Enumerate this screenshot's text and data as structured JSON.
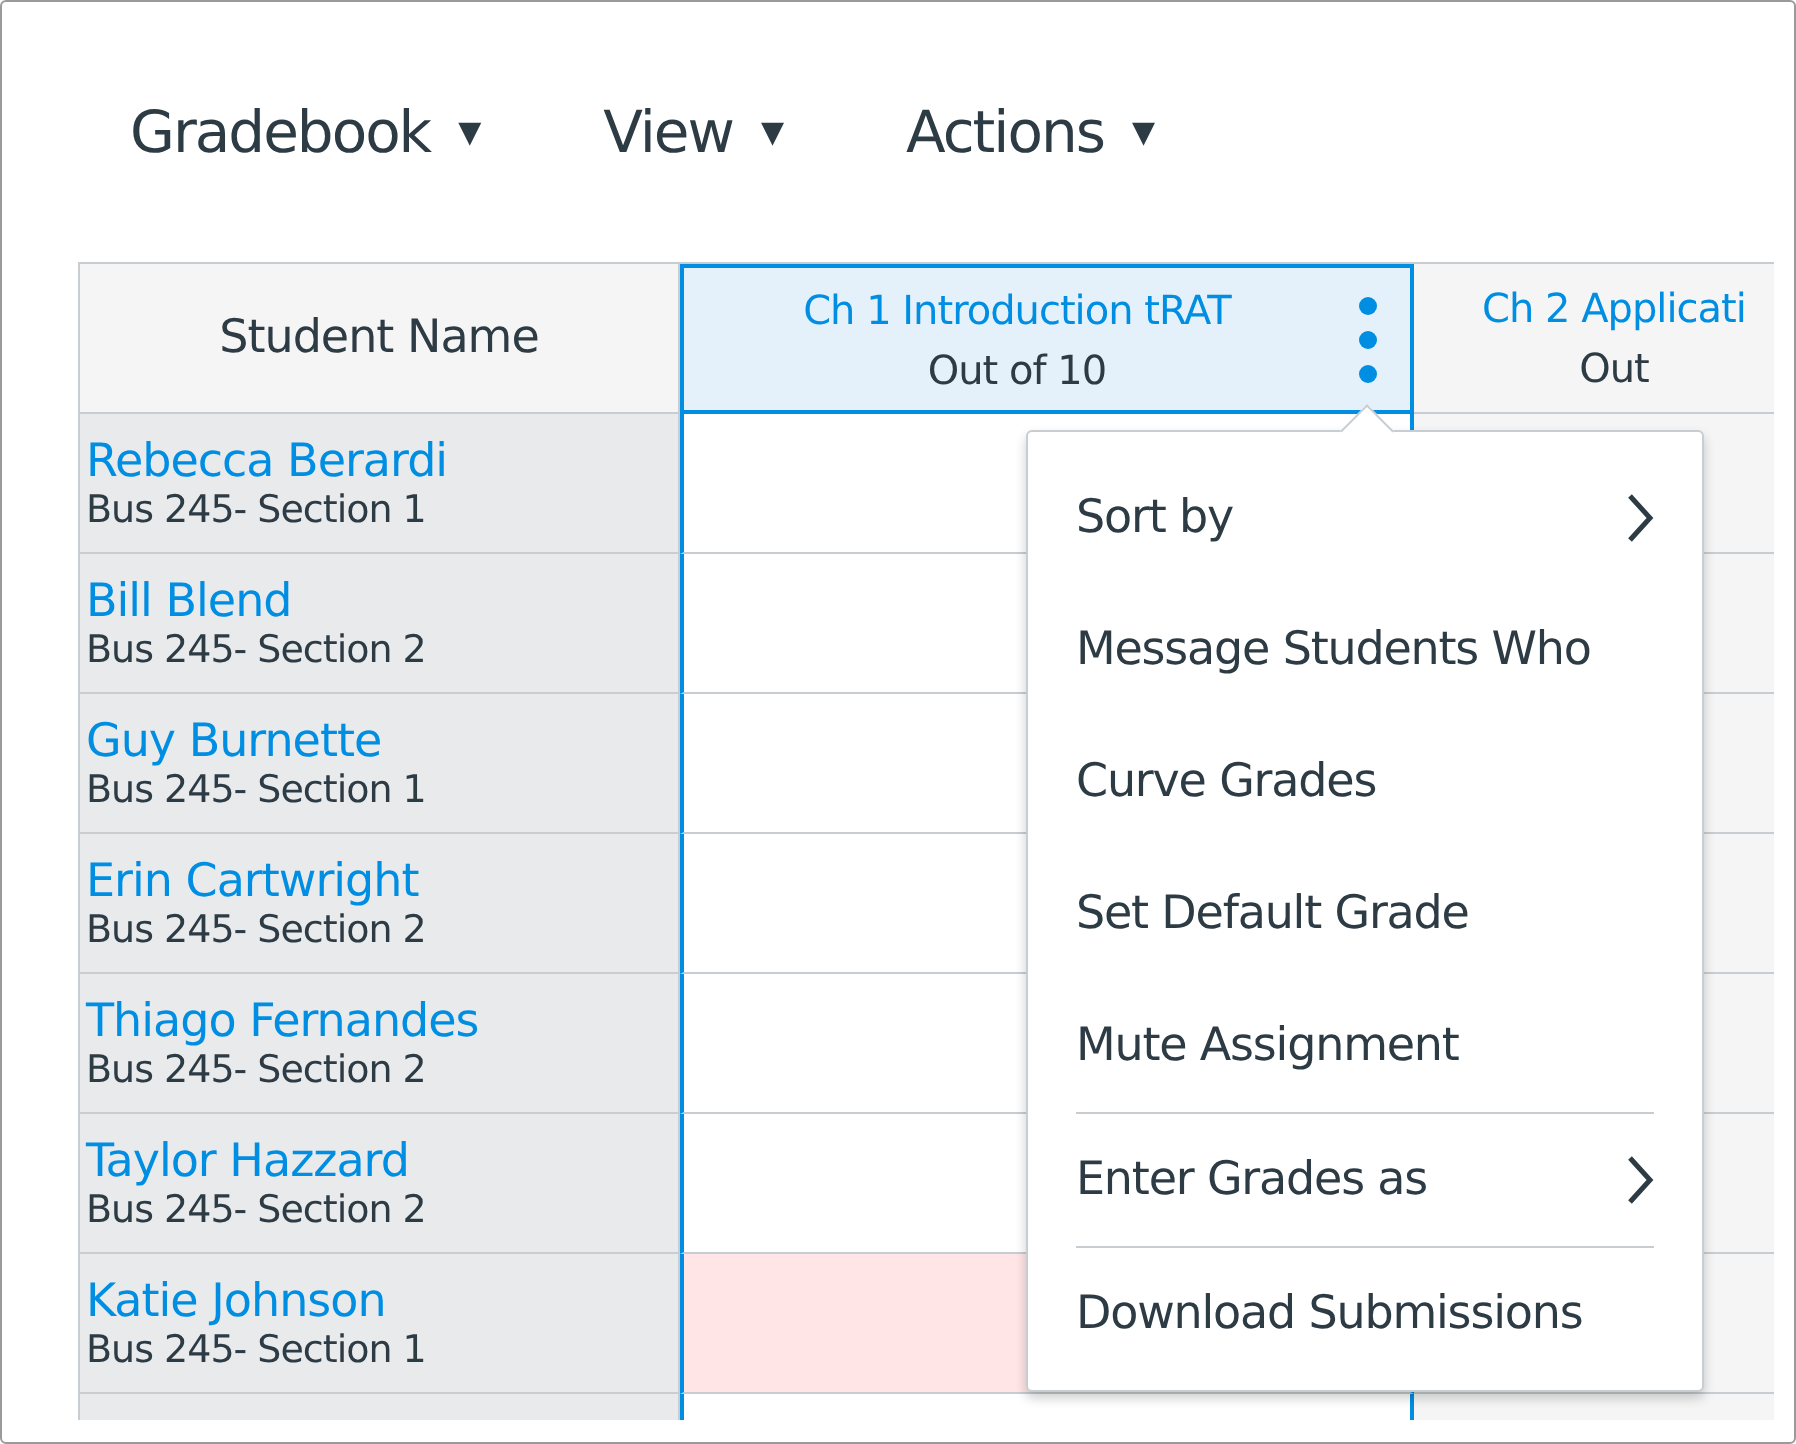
{
  "toolbar": [
    {
      "label": "Gradebook",
      "caret": "▼"
    },
    {
      "label": "View",
      "caret": "▼"
    },
    {
      "label": "Actions",
      "caret": "▼"
    }
  ],
  "grid": {
    "name_column": "Student Name",
    "columns": [
      {
        "title": "Ch 1 Introduction tRAT",
        "subtitle": "Out of 10",
        "selected": true
      },
      {
        "title": "Ch 2 Applicati",
        "subtitle": "Out",
        "selected": false
      }
    ],
    "rows": [
      {
        "name": "Rebecca Berardi",
        "section": "Bus 245- Section 1",
        "cells": [
          {
            "missing": false
          },
          {
            "missing": false
          }
        ]
      },
      {
        "name": "Bill Blend",
        "section": "Bus 245- Section 2",
        "cells": [
          {
            "missing": false
          },
          {
            "missing": false
          }
        ]
      },
      {
        "name": "Guy Burnette",
        "section": "Bus 245- Section 1",
        "cells": [
          {
            "missing": false
          },
          {
            "missing": false
          }
        ]
      },
      {
        "name": "Erin Cartwright",
        "section": "Bus 245- Section 2",
        "cells": [
          {
            "missing": false
          },
          {
            "missing": false
          }
        ]
      },
      {
        "name": "Thiago Fernandes",
        "section": "Bus 245- Section 2",
        "cells": [
          {
            "missing": false
          },
          {
            "missing": false
          }
        ]
      },
      {
        "name": "Taylor Hazzard",
        "section": "Bus 245- Section 2",
        "cells": [
          {
            "missing": false
          },
          {
            "missing": false
          }
        ]
      },
      {
        "name": "Katie Johnson",
        "section": "Bus 245- Section 1",
        "cells": [
          {
            "missing": true
          },
          {
            "missing": false
          }
        ]
      }
    ]
  },
  "menu": {
    "items": [
      {
        "label": "Sort by",
        "kind": "submenu",
        "divider_before": false
      },
      {
        "label": "Message Students Who",
        "kind": "plain",
        "divider_before": false
      },
      {
        "label": "Curve Grades",
        "kind": "plain",
        "divider_before": false
      },
      {
        "label": "Set Default Grade",
        "kind": "plain",
        "divider_before": false
      },
      {
        "label": "Mute Assignment",
        "kind": "plain",
        "divider_before": false
      },
      {
        "label": "Enter Grades as",
        "kind": "submenu",
        "divider_before": true
      },
      {
        "label": "Download Submissions",
        "kind": "plain",
        "divider_before": true
      }
    ]
  }
}
